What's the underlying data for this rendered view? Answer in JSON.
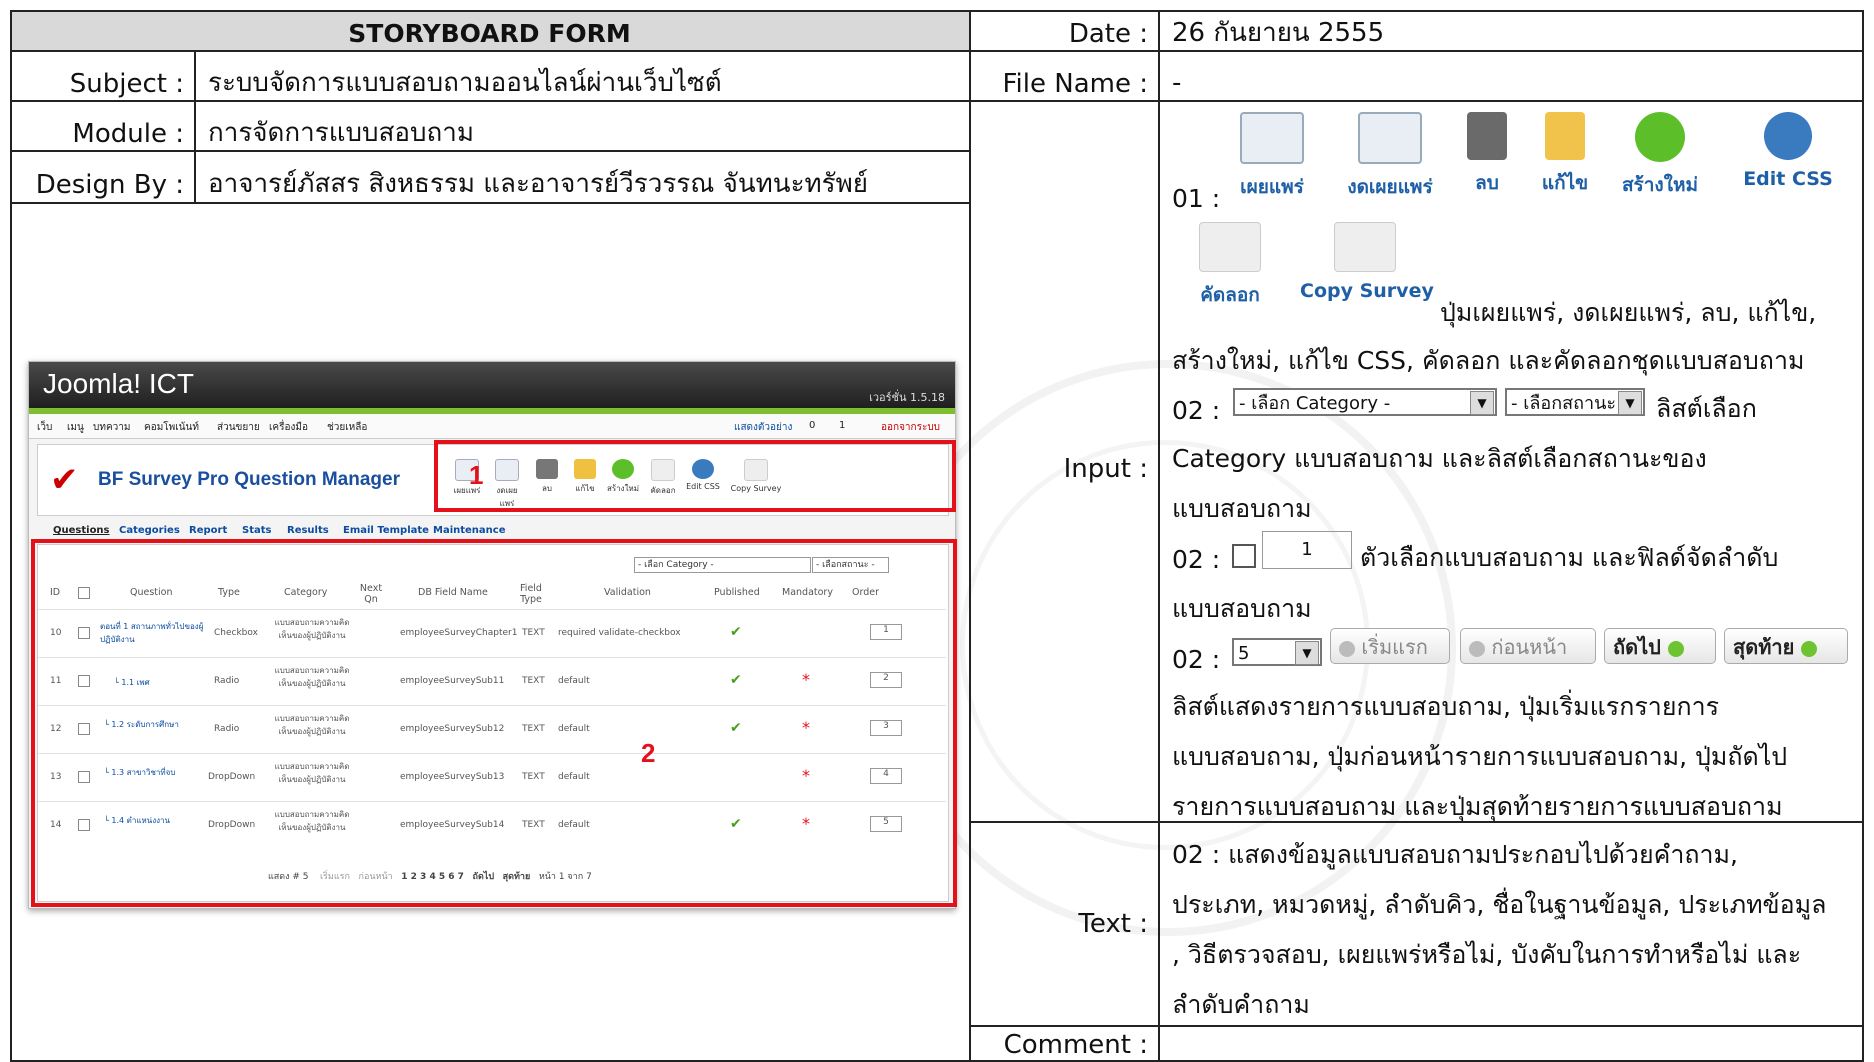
{
  "form": {
    "title": "STORYBOARD FORM",
    "date_label": "Date :",
    "date_value": "26 กันยายน 2555",
    "subject_label": "Subject :",
    "subject_value": "ระบบจัดการแบบสอบถามออนไลน์ผ่านเว็บไซต์",
    "filename_label": "File Name :",
    "filename_value": "-",
    "module_label": "Module :",
    "module_value": "การจัดการแบบสอบถาม",
    "design_label": "Design By :",
    "design_value": "อาจารย์ภัสสร สิงหธรรม และอาจารย์วีรวรรณ จันทนะทรัพย์",
    "input_label": "Input :",
    "text_label": "Text :",
    "comment_label": "Comment :"
  },
  "screenshot": {
    "app_title": "Joomla! ICT",
    "version": "เวอร์ชั่น 1.5.18",
    "menu": [
      "เว็บ",
      "เมนู",
      "บทความ",
      "คอมโพเน้นท์",
      "ส่วนขยาย",
      "เครื่องมือ",
      "ช่วยเหลือ"
    ],
    "menu_right": [
      "แสดงตัวอย่าง",
      "0",
      "1",
      "ออกจากระบบ"
    ],
    "component_title": "BF Survey Pro Question Manager",
    "toolbar": [
      "เผยแพร่",
      "งดเผยแพร่",
      "ลบ",
      "แก้ไข",
      "สร้างใหม่",
      "คัดลอก",
      "Edit CSS",
      "Copy Survey"
    ],
    "tabs": [
      "Questions",
      "Categories",
      "Report",
      "Stats",
      "Results",
      "Email Template",
      "Maintenance"
    ],
    "filter_category": "- เลือก Category -",
    "filter_state": "- เลือกสถานะ -",
    "columns": [
      "ID",
      "Question",
      "Type",
      "Category",
      "Next Qn",
      "DB Field Name",
      "Field Type",
      "Validation",
      "Published",
      "Mandatory",
      "Order"
    ],
    "rows": [
      {
        "id": "10",
        "question": "ตอนที่ 1 สถานภาพทั่วไปของผู้ปฏิบัติงาน",
        "type": "Checkbox",
        "category": "แบบสอบถามความคิดเห็นของผู้ปฏิบัติงาน",
        "db": "employeeSurveyChapter1",
        "ftype": "TEXT",
        "validation": "required validate-checkbox",
        "mandatory": "",
        "order": "1"
      },
      {
        "id": "11",
        "question": "└ 1.1 เพศ",
        "type": "Radio",
        "category": "แบบสอบถามความคิดเห็นของผู้ปฏิบัติงาน",
        "db": "employeeSurveySub11",
        "ftype": "TEXT",
        "validation": "default",
        "mandatory": "*",
        "order": "2"
      },
      {
        "id": "12",
        "question": "└ 1.2 ระดับการศึกษา",
        "type": "Radio",
        "category": "แบบสอบถามความคิดเห็นของผู้ปฏิบัติงาน",
        "db": "employeeSurveySub12",
        "ftype": "TEXT",
        "validation": "default",
        "mandatory": "*",
        "order": "3"
      },
      {
        "id": "13",
        "question": "└ 1.3 สาขาวิชาที่จบ",
        "type": "DropDown",
        "category": "แบบสอบถามความคิดเห็นของผู้ปฏิบัติงาน",
        "db": "employeeSurveySub13",
        "ftype": "TEXT",
        "validation": "default",
        "mandatory": "*",
        "order": "4"
      },
      {
        "id": "14",
        "question": "└ 1.4 ตำแหน่งงาน",
        "type": "DropDown",
        "category": "แบบสอบถามความคิดเห็นของผู้ปฏิบัติงาน",
        "db": "employeeSurveySub14",
        "ftype": "TEXT",
        "validation": "default",
        "mandatory": "*",
        "order": "5"
      }
    ],
    "pager_display": "แสดง # 5",
    "pager_first": "เริ่มแรก",
    "pager_prev": "ก่อนหน้า",
    "pager_pages": "1  2  3  4  5  6  7",
    "pager_next": "ถัดไป",
    "pager_last": "สุดท้าย",
    "pager_info": "หน้า 1 จาก 7",
    "marker_1": "1",
    "marker_2": "2"
  },
  "input_section": {
    "item01_prefix": "01 :",
    "buttons_row1": [
      "เผยแพร่",
      "งดเผยแพร่",
      "ลบ",
      "แก้ไข",
      "สร้างใหม่",
      "Edit CSS"
    ],
    "buttons_row2": [
      "คัดลอก",
      "Copy Survey"
    ],
    "desc01_a": "ปุ่มเผยแพร่, งดเผยแพร่, ลบ, แก้ไข,",
    "desc01_b": "สร้างใหม่, แก้ไข CSS, คัดลอก และคัดลอกชุดแบบสอบถาม",
    "item02a_prefix": "02 :",
    "select_category": "- เลือก Category -",
    "select_state": "- เลือกสถานะ -",
    "desc02a_a": "ลิสต์เลือก",
    "desc02a_b": "Category แบบสอบถาม และลิสต์เลือกสถานะของ",
    "desc02a_c": "แบบสอบถาม",
    "item02b_prefix": "02 :",
    "order_value": "1",
    "desc02b_a": "ตัวเลือกแบบสอบถาม และฟิลด์จัดลำดับ",
    "desc02b_b": "แบบสอบถาม",
    "item02c_prefix": "02 :",
    "list_value": "5",
    "nav_first": "เริ่มแรก",
    "nav_prev": "ก่อนหน้า",
    "nav_next": "ถัดไป",
    "nav_last": "สุดท้าย",
    "desc02c_a": "ลิสต์แสดงรายการแบบสอบถาม, ปุ่มเริ่มแรกรายการ",
    "desc02c_b": "แบบสอบถาม, ปุ่มก่อนหน้ารายการแบบสอบถาม, ปุ่มถัดไป",
    "desc02c_c": "รายการแบบสอบถาม และปุ่มสุดท้ายรายการแบบสอบถาม"
  },
  "text_section": {
    "line1": "02 : แสดงข้อมูลแบบสอบถามประกอบไปด้วยคำถาม,",
    "line2": "ประเภท, หมวดหมู่, ลำดับคิว, ชื่อในฐานข้อมูล, ประเภทข้อมูล",
    "line3": ", วิธีตรวจสอบ, เผยแพร่หรือไม่, บังคับในการทำหรือไม่ และ",
    "line4": "ลำดับคำถาม"
  }
}
